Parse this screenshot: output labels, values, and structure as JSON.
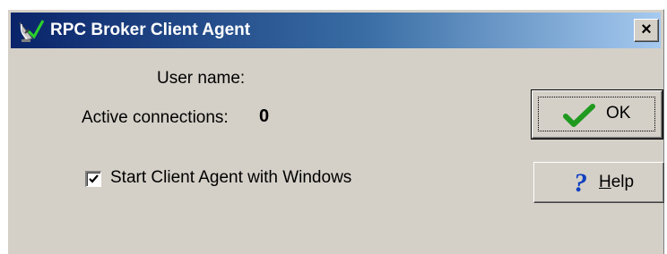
{
  "window": {
    "title": "RPC Broker Client Agent",
    "close_glyph": "×",
    "icon": "satellite-dish-icon"
  },
  "content": {
    "user_name_label": "User name:",
    "user_name_value": "",
    "active_connections_label": "Active connections:",
    "active_connections_count": "0",
    "start_with_windows_label": "Start Client Agent with Windows",
    "start_with_windows_checked": true
  },
  "buttons": {
    "ok": {
      "label": "OK",
      "icon": "checkmark-icon"
    },
    "help": {
      "mnemonic": "H",
      "label_rest": "elp",
      "icon": "question-mark-icon",
      "icon_glyph": "?"
    }
  },
  "colors": {
    "titlebar_start": "#0a246a",
    "titlebar_end": "#a6caf0",
    "face": "#d4d0c8",
    "check_green": "#1f9a1f",
    "help_blue": "#1040c0"
  }
}
